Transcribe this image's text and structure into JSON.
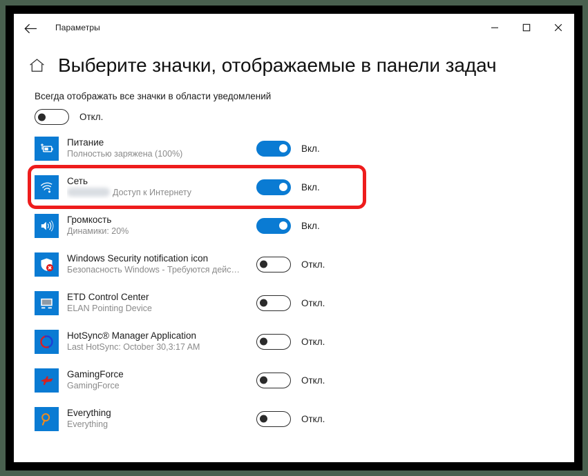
{
  "window": {
    "app_title": "Параметры",
    "back_icon": "back-arrow-icon",
    "minimize_label": "—",
    "maximize_label": "▢",
    "close_label": "✕"
  },
  "header": {
    "home_icon": "home-icon",
    "title": "Выберите значки, отображаемые в панели задач"
  },
  "colors": {
    "accent": "#0a7bd3",
    "highlight": "#ee1c1c",
    "text": "#1b1b1b",
    "subtext": "#8a8a8a"
  },
  "master": {
    "label": "Всегда отображать все значки в области уведомлений",
    "state": "off",
    "state_label": "Откл."
  },
  "rows": [
    {
      "icon": "battery-charging-icon",
      "title": "Питание",
      "subtitle": "Полностью заряжена (100%)",
      "state": "on",
      "state_label": "Вкл.",
      "highlighted": false,
      "blurred_prefix": false
    },
    {
      "icon": "wifi-icon",
      "title": "Сеть",
      "subtitle": "Доступ к Интернету",
      "state": "on",
      "state_label": "Вкл.",
      "highlighted": true,
      "blurred_prefix": true
    },
    {
      "icon": "speaker-volume-icon",
      "title": "Громкость",
      "subtitle": "Динамики: 20%",
      "state": "on",
      "state_label": "Вкл.",
      "highlighted": false,
      "blurred_prefix": false
    },
    {
      "icon": "shield-alert-icon",
      "title": "Windows Security notification icon",
      "subtitle": "Безопасность Windows - Требуются дейс…",
      "state": "off",
      "state_label": "Откл.",
      "highlighted": false,
      "blurred_prefix": false
    },
    {
      "icon": "monitor-icon",
      "title": "ETD Control Center",
      "subtitle": "ELAN Pointing Device",
      "state": "off",
      "state_label": "Откл.",
      "highlighted": false,
      "blurred_prefix": false
    },
    {
      "icon": "hotsync-circular-arrows-icon",
      "title": "HotSync® Manager Application",
      "subtitle": "Last HotSync: October 30,3:17 AM",
      "state": "off",
      "state_label": "Откл.",
      "highlighted": false,
      "blurred_prefix": false
    },
    {
      "icon": "jet-plane-icon",
      "title": "GamingForce",
      "subtitle": "GamingForce",
      "state": "off",
      "state_label": "Откл.",
      "highlighted": false,
      "blurred_prefix": false
    },
    {
      "icon": "magnifier-icon",
      "title": "Everything",
      "subtitle": "Everything",
      "state": "off",
      "state_label": "Откл.",
      "highlighted": false,
      "blurred_prefix": false
    }
  ]
}
